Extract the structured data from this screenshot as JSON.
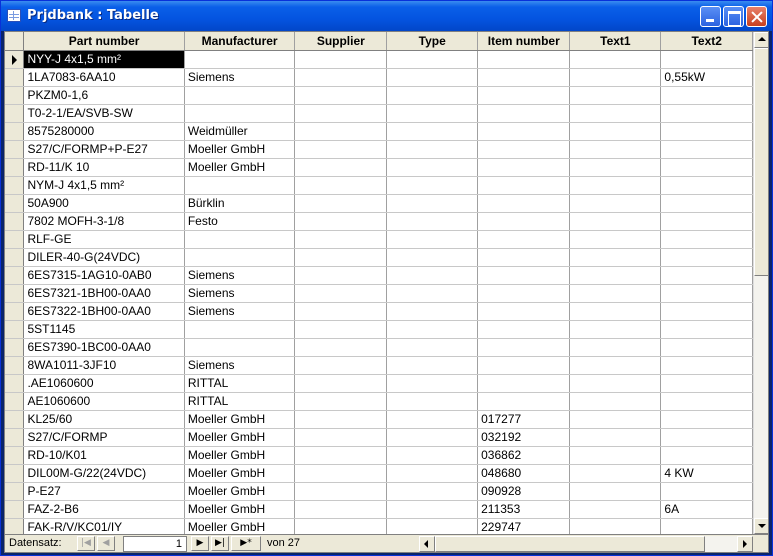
{
  "window": {
    "title": "Prjdbank : Tabelle"
  },
  "table": {
    "columns": [
      "Part number",
      "Manufacturer",
      "Supplier",
      "Type",
      "Item number",
      "Text1",
      "Text2"
    ],
    "rows": [
      [
        "NYY-J 4x1,5 mm²",
        "",
        "",
        "",
        "",
        "",
        ""
      ],
      [
        "1LA7083-6AA10",
        "Siemens",
        "",
        "",
        "",
        "",
        "0,55kW"
      ],
      [
        "PKZM0-1,6",
        "",
        "",
        "",
        "",
        "",
        ""
      ],
      [
        "T0-2-1/EA/SVB-SW",
        "",
        "",
        "",
        "",
        "",
        ""
      ],
      [
        "8575280000",
        "Weidmüller",
        "",
        "",
        "",
        "",
        ""
      ],
      [
        "S27/C/FORMP+P-E27",
        "Moeller GmbH",
        "",
        "",
        "",
        "",
        ""
      ],
      [
        "RD-11/K 10",
        "Moeller GmbH",
        "",
        "",
        "",
        "",
        ""
      ],
      [
        "NYM-J 4x1,5 mm²",
        "",
        "",
        "",
        "",
        "",
        ""
      ],
      [
        "50A900",
        "Bürklin",
        "",
        "",
        "",
        "",
        ""
      ],
      [
        "7802 MOFH-3-1/8",
        "Festo",
        "",
        "",
        "",
        "",
        ""
      ],
      [
        "RLF-GE",
        "",
        "",
        "",
        "",
        "",
        ""
      ],
      [
        "DILER-40-G(24VDC)",
        "",
        "",
        "",
        "",
        "",
        ""
      ],
      [
        "6ES7315-1AG10-0AB0",
        "Siemens",
        "",
        "",
        "",
        "",
        ""
      ],
      [
        "6ES7321-1BH00-0AA0",
        "Siemens",
        "",
        "",
        "",
        "",
        ""
      ],
      [
        "6ES7322-1BH00-0AA0",
        "Siemens",
        "",
        "",
        "",
        "",
        ""
      ],
      [
        "5ST1145",
        "",
        "",
        "",
        "",
        "",
        ""
      ],
      [
        "6ES7390-1BC00-0AA0",
        "",
        "",
        "",
        "",
        "",
        ""
      ],
      [
        "8WA1011-3JF10",
        "Siemens",
        "",
        "",
        "",
        "",
        ""
      ],
      [
        ".AE1060600",
        "RITTAL",
        "",
        "",
        "",
        "",
        ""
      ],
      [
        "AE1060600",
        "RITTAL",
        "",
        "",
        "",
        "",
        ""
      ],
      [
        "KL25/60",
        "Moeller GmbH",
        "",
        "",
        "017277",
        "",
        ""
      ],
      [
        "S27/C/FORMP",
        "Moeller GmbH",
        "",
        "",
        "032192",
        "",
        ""
      ],
      [
        "RD-10/K01",
        "Moeller GmbH",
        "",
        "",
        "036862",
        "",
        ""
      ],
      [
        "DIL00M-G/22(24VDC)",
        "Moeller GmbH",
        "",
        "",
        "048680",
        "",
        "4 KW"
      ],
      [
        "P-E27",
        "Moeller GmbH",
        "",
        "",
        "090928",
        "",
        ""
      ],
      [
        "FAZ-2-B6",
        "Moeller GmbH",
        "",
        "",
        "211353",
        "",
        "6A"
      ],
      [
        "FAK-R/V/KC01/IY",
        "Moeller GmbH",
        "",
        "",
        "229747",
        "",
        ""
      ]
    ]
  },
  "navigation": {
    "label": "Datensatz:",
    "first_icon": "|◀",
    "prev_icon": "◀",
    "next_icon": "▶",
    "last_icon": "▶|",
    "new_icon": "▶*",
    "current_record": "1",
    "of_text": "von  27"
  },
  "colors": {
    "titlebar": "#0454E0",
    "header_bg": "#ECE9D8",
    "selected_cell": "#000000"
  }
}
